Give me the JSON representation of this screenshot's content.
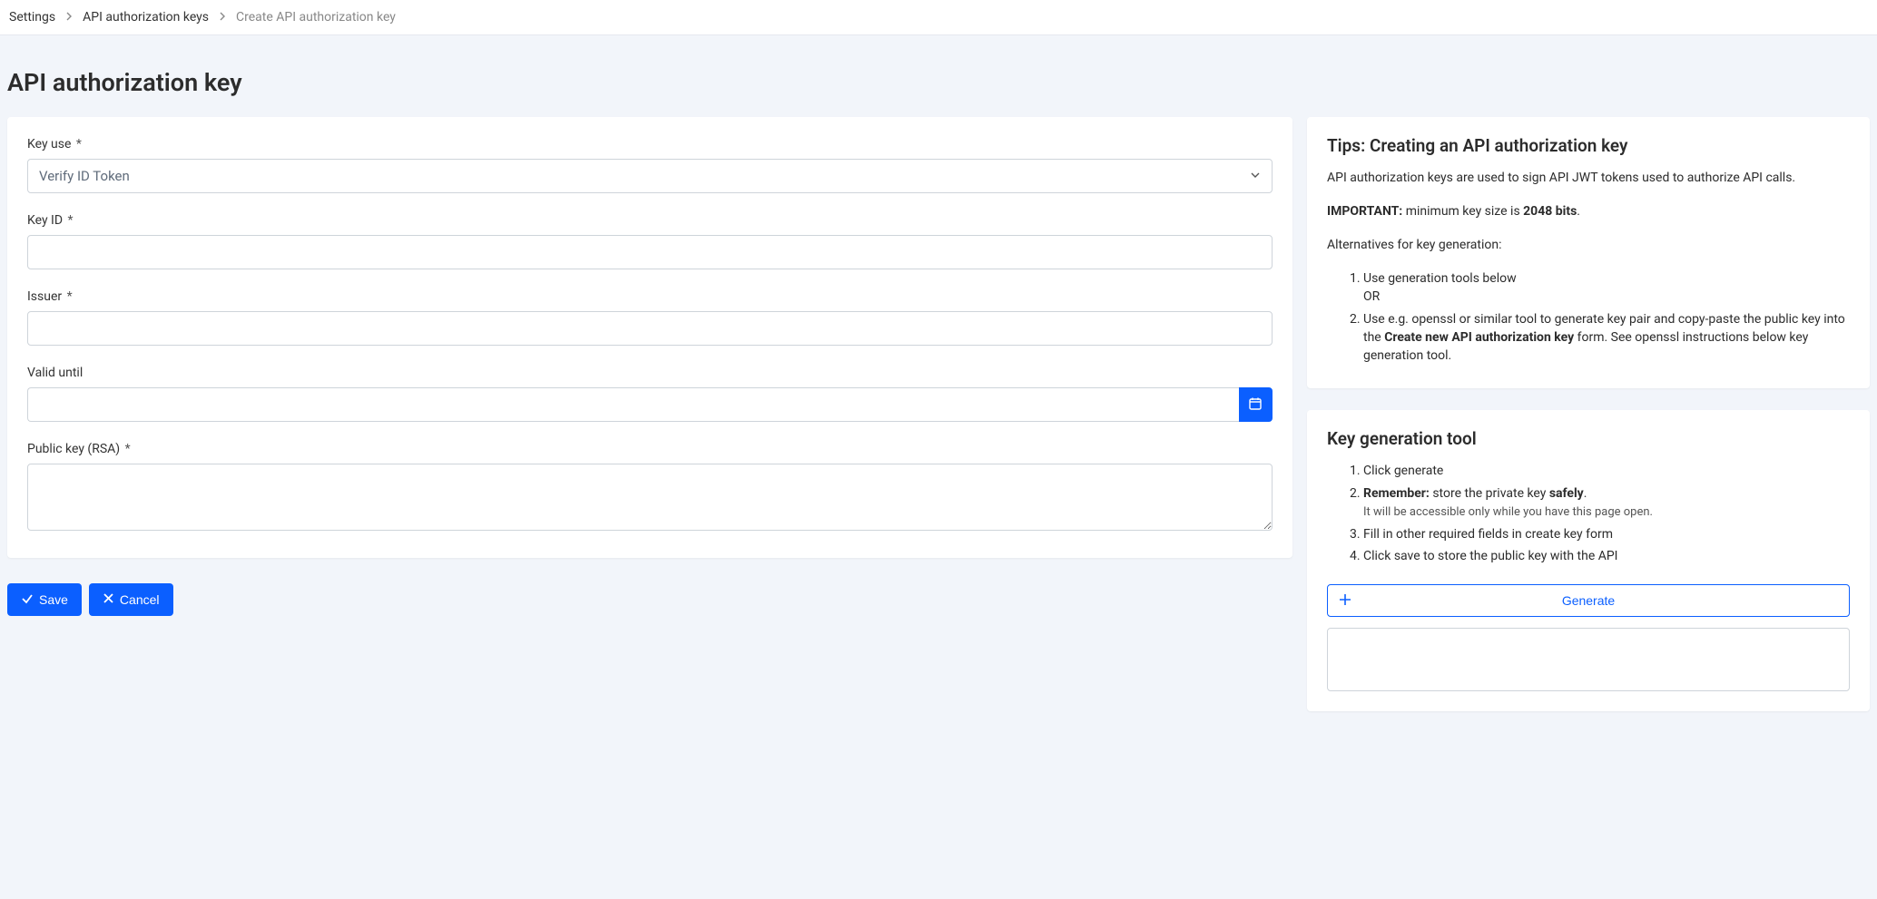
{
  "breadcrumb": {
    "items": [
      {
        "label": "Settings"
      },
      {
        "label": "API authorization keys"
      },
      {
        "label": "Create API authorization key"
      }
    ]
  },
  "page_title": "API authorization key",
  "form": {
    "key_use": {
      "label": "Key use",
      "value": "Verify ID Token"
    },
    "key_id": {
      "label": "Key ID",
      "value": ""
    },
    "issuer": {
      "label": "Issuer",
      "value": ""
    },
    "valid_until": {
      "label": "Valid until",
      "value": ""
    },
    "public_key": {
      "label": "Public key (RSA)",
      "value": ""
    }
  },
  "buttons": {
    "save": "Save",
    "cancel": "Cancel",
    "generate": "Generate"
  },
  "tips": {
    "title": "Tips: Creating an API authorization key",
    "intro": "API authorization keys are used to sign API JWT tokens used to authorize API calls.",
    "important_label": "IMPORTANT:",
    "important_text_a": " minimum key size is ",
    "important_bits": "2048 bits",
    "important_text_b": ".",
    "alt_intro": "Alternatives for key generation:",
    "alt_items": [
      {
        "text": "Use generation tools below",
        "sub": "OR"
      },
      {
        "text_a": "Use e.g. openssl or similar tool to generate key pair and copy-paste the public key into the ",
        "bold": "Create new API authorization key",
        "text_b": " form. See openssl instructions below key generation tool."
      }
    ]
  },
  "gen_tool": {
    "title": "Key generation tool",
    "steps": {
      "s1": "Click generate",
      "s2_a": "Remember:",
      "s2_b": " store the private key ",
      "s2_c": "safely",
      "s2_d": ".",
      "s2_note": "It will be accessible only while you have this page open.",
      "s3": "Fill in other required fields in create key form",
      "s4": "Click save to store the public key with the API"
    }
  }
}
